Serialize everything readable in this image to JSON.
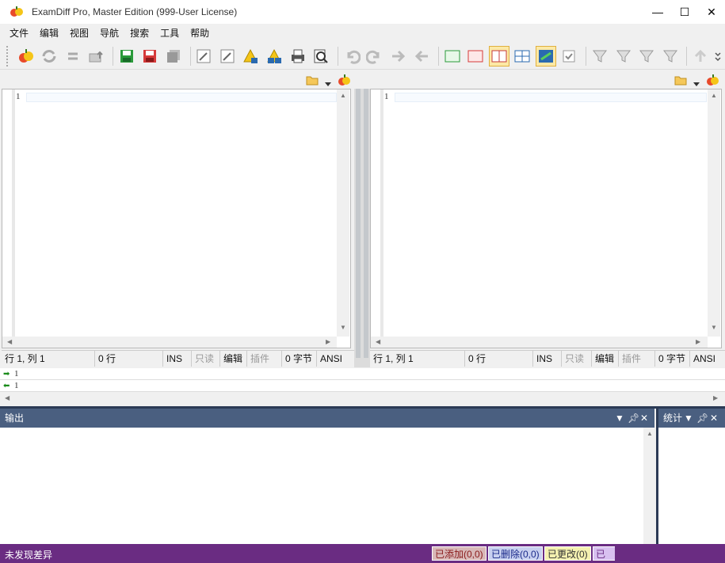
{
  "window": {
    "title": "ExamDiff Pro, Master Edition (999-User License)",
    "min_glyph": "—",
    "max_glyph": "☐",
    "close_glyph": "✕"
  },
  "menu": [
    "文件",
    "编辑",
    "视图",
    "导航",
    "搜索",
    "工具",
    "帮助"
  ],
  "toolbar": {
    "icons": [
      "compare-icon",
      "recompare-icon",
      "swap-icon",
      "open-folder-up-icon",
      "save-left-icon",
      "save-right-icon",
      "save-all-icon",
      "edit-left-icon",
      "edit-right-icon",
      "warning-save-icon",
      "warning-save-right-icon",
      "print-icon",
      "print-preview-icon",
      "undo-icon",
      "redo-icon",
      "next-diff-icon",
      "prev-diff-icon",
      "view-added-icon",
      "view-deleted-icon",
      "view-changed-icon",
      "view-grid-icon",
      "view-sync-icon",
      "checkbox-icon",
      "filter1-icon",
      "filter2-icon",
      "filter3-icon",
      "filter4-icon",
      "up-icon"
    ]
  },
  "left": {
    "line_number": "1",
    "status": [
      "行 1, 列 1",
      "0 行",
      "INS",
      "只读",
      "编辑",
      "插件",
      "0 字节",
      "ANSI"
    ]
  },
  "right": {
    "line_number": "1",
    "status": [
      "行 1, 列 1",
      "0 行",
      "INS",
      "只读",
      "编辑",
      "插件",
      "0 字节",
      "ANSI"
    ]
  },
  "mini": {
    "line1": "1",
    "line2": "1"
  },
  "output_panel": {
    "title": "输出",
    "pin": "✕"
  },
  "stats_panel": {
    "title": "统计"
  },
  "statusbar": {
    "text": "未发现差异",
    "added": "已添加(0,0)",
    "deleted": "已删除(0,0)",
    "changed": "已更改(0)",
    "more": "已更"
  },
  "colors": {
    "accent_panel": "#4a5f80",
    "statusbar": "#6a2c82",
    "added_bg": "#d8b8b8",
    "deleted_bg": "#c8d0f0",
    "changed_bg": "#f4f0b0",
    "more_bg": "#d8c0f0"
  }
}
